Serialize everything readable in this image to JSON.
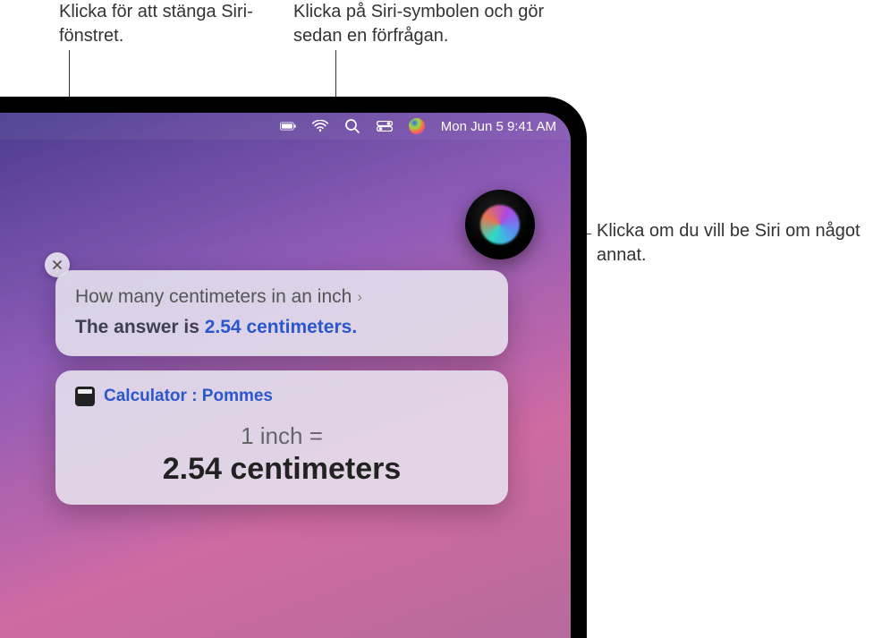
{
  "callouts": {
    "close_siri": "Klicka för att stänga Siri-fönstret.",
    "click_siri_menubar": "Klicka på Siri-symbolen och gör sedan en förfrågan.",
    "ask_siri_again": "Klicka om du vill be Siri om något annat."
  },
  "menubar": {
    "date_time": "Mon Jun 5  9:41 AM"
  },
  "siri": {
    "query": "How many centimeters in an inch",
    "answer_prefix": "The answer is ",
    "answer_value": "2.54 centimeters.",
    "calc_header": "Calculator : Pommes",
    "conv_top": "1 inch =",
    "conv_bottom": "2.54 centimeters"
  }
}
